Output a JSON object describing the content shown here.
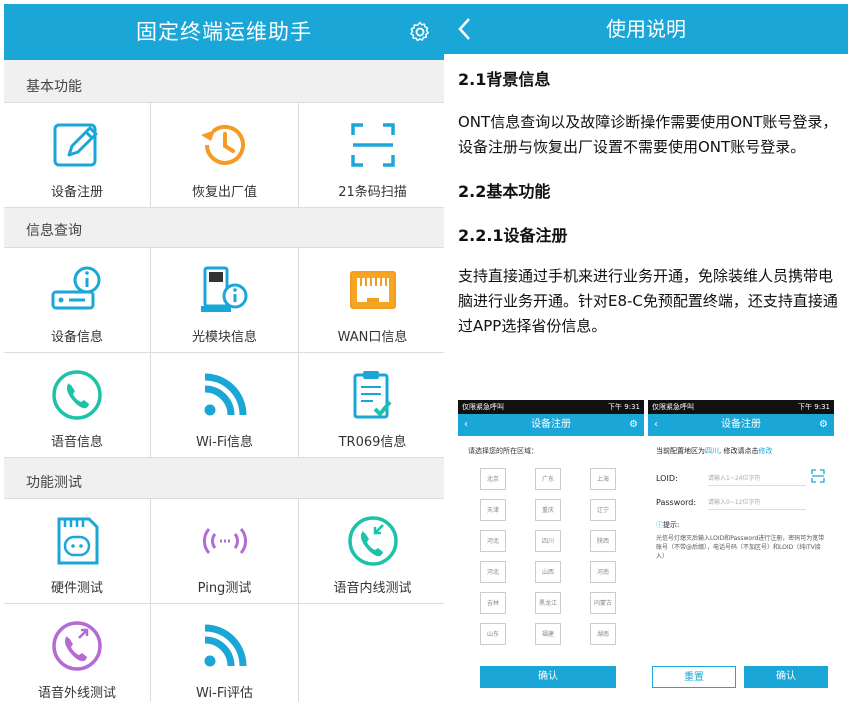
{
  "left": {
    "title": "固定终端运维助手",
    "sections": [
      {
        "label": "基本功能",
        "items": [
          {
            "label": "设备注册",
            "icon": "edit-icon"
          },
          {
            "label": "恢复出厂值",
            "icon": "restore-clock-icon"
          },
          {
            "label": "21条码扫描",
            "icon": "scan-icon"
          }
        ]
      },
      {
        "label": "信息查询",
        "items": [
          {
            "label": "设备信息",
            "icon": "device-info-icon"
          },
          {
            "label": "光模块信息",
            "icon": "optical-module-icon"
          },
          {
            "label": "WAN口信息",
            "icon": "ethernet-port-icon"
          },
          {
            "label": "语音信息",
            "icon": "phone-icon"
          },
          {
            "label": "Wi-Fi信息",
            "icon": "wifi-icon"
          },
          {
            "label": "TR069信息",
            "icon": "clipboard-check-icon"
          }
        ]
      },
      {
        "label": "功能测试",
        "items": [
          {
            "label": "硬件测试",
            "icon": "sd-card-icon"
          },
          {
            "label": "Ping测试",
            "icon": "ping-signal-icon"
          },
          {
            "label": "语音内线测试",
            "icon": "phone-internal-icon"
          },
          {
            "label": "语音外线测试",
            "icon": "phone-external-icon"
          },
          {
            "label": "Wi-Fi评估",
            "icon": "wifi-icon"
          }
        ]
      }
    ]
  },
  "right": {
    "title": "使用说明",
    "doc": {
      "h1": "2.1背景信息",
      "p1": "ONT信息查询以及故障诊断操作需要使用ONT账号登录，设备注册与恢复出厂设置不需要使用ONT账号登录。",
      "h2": "2.2基本功能",
      "h3": "2.2.1设备注册",
      "p2": "支持直接通过手机来进行业务开通，免除装维人员携带电脑进行业务开通。针对E8-C免预配置终端，还支持直接通过APP选择省份信息。"
    },
    "thumb1": {
      "status_left": "仅限紧急呼叫",
      "status_right": "下午 9:31",
      "title": "设备注册",
      "hint": "请选择您的所在区域：",
      "provinces": [
        "北京",
        "广东",
        "上海",
        "天津",
        "重庆",
        "辽宁",
        "河北",
        "四川",
        "陕西",
        "河北",
        "山西",
        "河南",
        "吉林",
        "黑龙江",
        "内蒙古",
        "山东",
        "福建",
        "湖南"
      ],
      "confirm": "确认"
    },
    "thumb2": {
      "status_left": "仅限紧急呼叫",
      "status_right": "下午 9:31",
      "title": "设备注册",
      "region_prefix": "当前配置地区为",
      "region_value": "四川",
      "region_mid": ", 修改请点击",
      "region_link": "修改",
      "loid_label": "LOID:",
      "loid_placeholder": "请输入1~24位字符",
      "password_label": "Password:",
      "password_placeholder": "请输入0~12位字符",
      "tip_title": "提示:",
      "tip_text": "光信号灯熄灭后输入LOID和Password进行注册，密码可为宽带账号（不带@后缀），电话号码（不加区号）和LOID（纯ITV接入）",
      "reset": "重置",
      "confirm": "确认"
    }
  },
  "colors": {
    "accent": "#1aa7d8",
    "orange": "#f59a23",
    "purple": "#b46bd6",
    "teal": "#1cc3a8"
  }
}
